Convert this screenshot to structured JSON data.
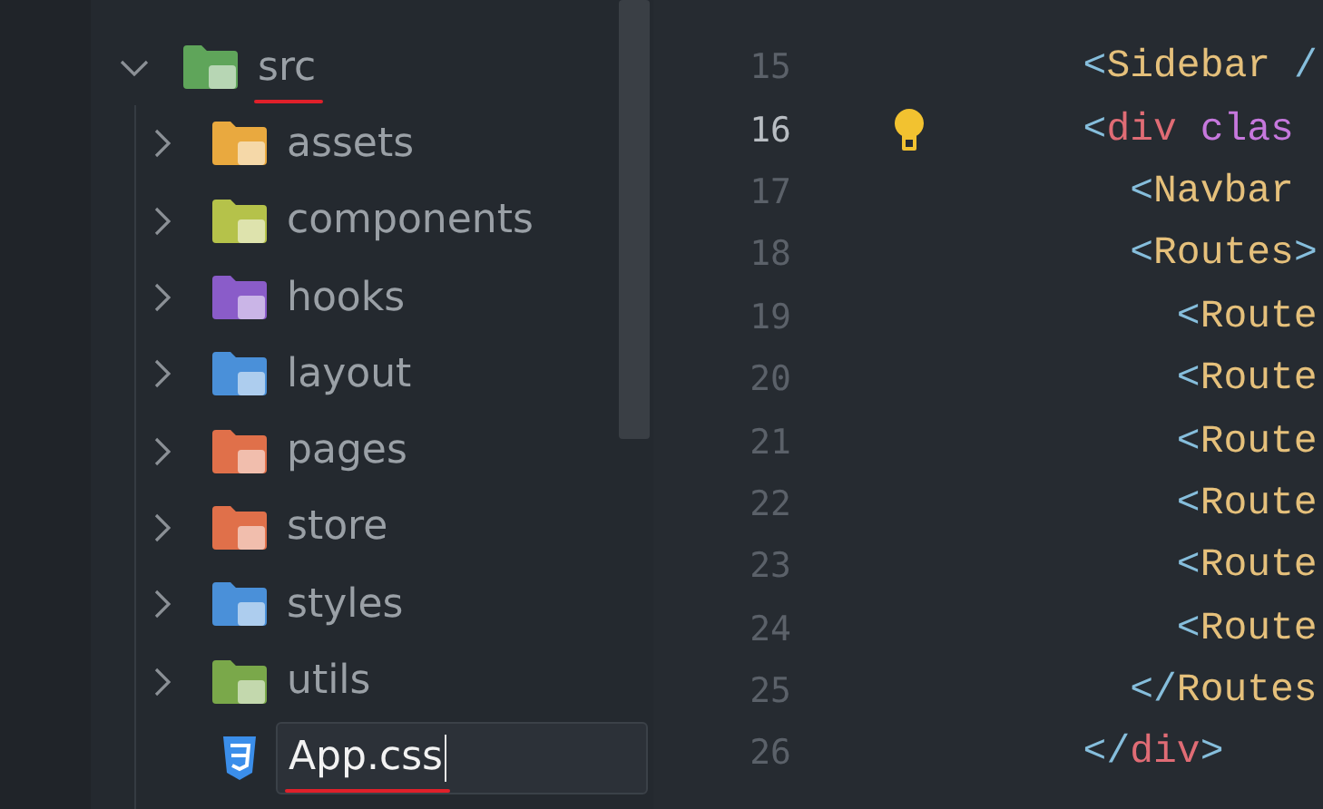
{
  "explorer": {
    "tree": [
      {
        "label": "src",
        "kind": "folder",
        "expanded": true,
        "color": "#5fa55a",
        "annotated": true,
        "children": [
          {
            "label": "assets",
            "kind": "folder",
            "expanded": false,
            "color": "#e9a93f",
            "annotated": false
          },
          {
            "label": "components",
            "kind": "folder",
            "expanded": false,
            "color": "#b5c24a",
            "annotated": false
          },
          {
            "label": "hooks",
            "kind": "folder",
            "expanded": false,
            "color": "#8a5cc9",
            "annotated": false
          },
          {
            "label": "layout",
            "kind": "folder",
            "expanded": false,
            "color": "#4a90d9",
            "annotated": false
          },
          {
            "label": "pages",
            "kind": "folder",
            "expanded": false,
            "color": "#e0704a",
            "annotated": false
          },
          {
            "label": "store",
            "kind": "folder",
            "expanded": false,
            "color": "#e0704a",
            "annotated": false
          },
          {
            "label": "styles",
            "kind": "folder",
            "expanded": false,
            "color": "#4a90d9",
            "annotated": false
          },
          {
            "label": "utils",
            "kind": "folder",
            "expanded": false,
            "color": "#7aa84a",
            "annotated": false
          },
          {
            "label": "App.css",
            "kind": "css-file",
            "editing": true,
            "annotated": true
          }
        ]
      }
    ]
  },
  "editor": {
    "lines": [
      {
        "number": "15",
        "current": false,
        "tokens": [
          {
            "kind": "punct",
            "text": "  <"
          },
          {
            "kind": "component",
            "text": "Sidebar "
          },
          {
            "kind": "punct",
            "text": "/"
          }
        ]
      },
      {
        "number": "16",
        "current": true,
        "lightbulb": true,
        "tokens": [
          {
            "kind": "punct",
            "text": "  <"
          },
          {
            "kind": "tag",
            "text": "div "
          },
          {
            "kind": "attr",
            "text": "clas"
          }
        ]
      },
      {
        "number": "17",
        "current": false,
        "tokens": [
          {
            "kind": "punct",
            "text": "    <"
          },
          {
            "kind": "component",
            "text": "Navbar"
          }
        ]
      },
      {
        "number": "18",
        "current": false,
        "tokens": [
          {
            "kind": "punct",
            "text": "    <"
          },
          {
            "kind": "component",
            "text": "Routes"
          },
          {
            "kind": "punct",
            "text": ">"
          }
        ]
      },
      {
        "number": "19",
        "current": false,
        "tokens": [
          {
            "kind": "punct",
            "text": "      <"
          },
          {
            "kind": "component",
            "text": "Route"
          }
        ]
      },
      {
        "number": "20",
        "current": false,
        "tokens": [
          {
            "kind": "punct",
            "text": "      <"
          },
          {
            "kind": "component",
            "text": "Route"
          }
        ]
      },
      {
        "number": "21",
        "current": false,
        "tokens": [
          {
            "kind": "punct",
            "text": "      <"
          },
          {
            "kind": "component",
            "text": "Route"
          }
        ]
      },
      {
        "number": "22",
        "current": false,
        "tokens": [
          {
            "kind": "punct",
            "text": "      <"
          },
          {
            "kind": "component",
            "text": "Route"
          }
        ]
      },
      {
        "number": "23",
        "current": false,
        "tokens": [
          {
            "kind": "punct",
            "text": "      <"
          },
          {
            "kind": "component",
            "text": "Route"
          }
        ]
      },
      {
        "number": "24",
        "current": false,
        "tokens": [
          {
            "kind": "punct",
            "text": "      <"
          },
          {
            "kind": "component",
            "text": "Route"
          }
        ]
      },
      {
        "number": "25",
        "current": false,
        "tokens": [
          {
            "kind": "punct",
            "text": "    </"
          },
          {
            "kind": "component",
            "text": "Routes"
          }
        ]
      },
      {
        "number": "26",
        "current": false,
        "tokens": [
          {
            "kind": "punct",
            "text": "  </"
          },
          {
            "kind": "tag",
            "text": "div"
          },
          {
            "kind": "punct",
            "text": ">"
          }
        ]
      }
    ]
  }
}
